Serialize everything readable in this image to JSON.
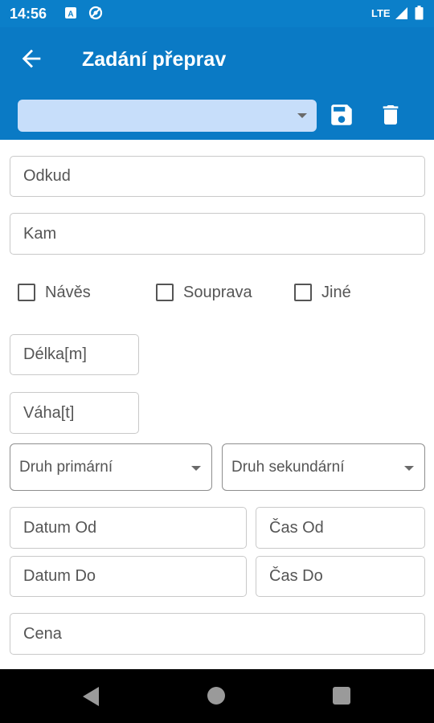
{
  "status_bar": {
    "time": "14:56",
    "network": "LTE",
    "icons": [
      "a-notification-icon",
      "sync-blocked-icon",
      "signal-icon",
      "battery-icon"
    ]
  },
  "app_bar": {
    "title": "Zadání přeprav",
    "back_icon": "arrow-back-icon",
    "select_value": "",
    "save_icon": "save-icon",
    "delete_icon": "trash-icon"
  },
  "form": {
    "from_placeholder": "Odkud",
    "to_placeholder": "Kam",
    "checkboxes": [
      {
        "label": "Návěs",
        "checked": false
      },
      {
        "label": "Souprava",
        "checked": false
      },
      {
        "label": "Jiné",
        "checked": false
      }
    ],
    "length_placeholder": "Délka[m]",
    "weight_placeholder": "Váha[t]",
    "primary_type": "Druh primární",
    "secondary_type": "Druh sekundární",
    "date_from_placeholder": "Datum Od",
    "time_from_placeholder": "Čas Od",
    "date_to_placeholder": "Datum Do",
    "time_to_placeholder": "Čas Do",
    "price_placeholder": "Cena"
  },
  "colors": {
    "status_bar": "#0b7fc9",
    "app_bar": "#0a7ac5",
    "select_bg": "#c7defa",
    "field_border": "#c9c9c9",
    "nav_bar": "#000000"
  },
  "nav_bar": {
    "icons": [
      "nav-back-icon",
      "nav-home-icon",
      "nav-recents-icon"
    ]
  }
}
